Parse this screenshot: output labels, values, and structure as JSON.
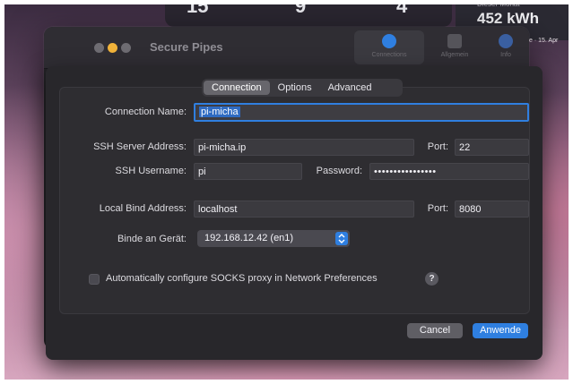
{
  "widgets": {
    "calendar_numbers": [
      "15",
      "9",
      "4"
    ],
    "energy_label": "Dieser Monat",
    "energy_value": "452 kWh",
    "date_text": "e · 15. Apr"
  },
  "window": {
    "title": "Secure Pipes",
    "toolbar": [
      {
        "label": "Connections",
        "icon": "globe-icon"
      },
      {
        "label": "Allgemein",
        "icon": "gear-icon"
      },
      {
        "label": "Info",
        "icon": "info-icon"
      }
    ]
  },
  "sheet": {
    "tabs": [
      "Connection",
      "Options",
      "Advanced"
    ],
    "active_tab": "Connection",
    "connection_name_label": "Connection Name:",
    "connection_name_value": "pi-micha",
    "ssh_server_label": "SSH Server Address:",
    "ssh_server_value": "pi-micha.ip",
    "ssh_port_label": "Port:",
    "ssh_port_value": "22",
    "ssh_username_label": "SSH Username:",
    "ssh_username_value": "pi",
    "password_label": "Password:",
    "password_value": "••••••••••••••••",
    "local_bind_label": "Local Bind Address:",
    "local_bind_value": "localhost",
    "local_port_label": "Port:",
    "local_port_value": "8080",
    "bind_device_label": "Binde an Gerät:",
    "bind_device_value": "192.168.12.42 (en1)",
    "socks_checkbox_label": "Automatically configure SOCKS proxy in Network Preferences",
    "socks_checked": false,
    "help_glyph": "?",
    "cancel_label": "Cancel",
    "apply_label": "Anwende"
  },
  "colors": {
    "accent": "#2f7fe0",
    "window_bg": "#232226"
  }
}
